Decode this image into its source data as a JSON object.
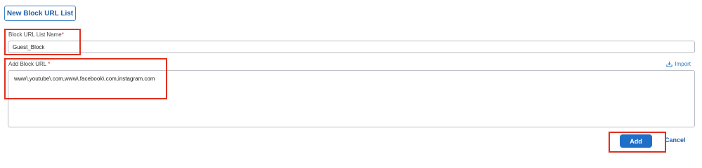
{
  "form": {
    "new_list_button": "New Block URL List",
    "name_label": "Block URL List Name",
    "name_required_mark": "*",
    "name_value": "Guest_Block",
    "url_label": "Add Block URL",
    "url_required_mark": "*",
    "url_value": "www\\.youtube\\.com,www\\.facebook\\.com,instagram.com",
    "import_label": "Import",
    "add_button": "Add",
    "cancel_link": "Cancel"
  },
  "icons": {
    "import": "download-tray-icon"
  },
  "colors": {
    "primary": "#1f6fc8",
    "link": "#2d7fc6",
    "annotation": "#e0301e"
  }
}
